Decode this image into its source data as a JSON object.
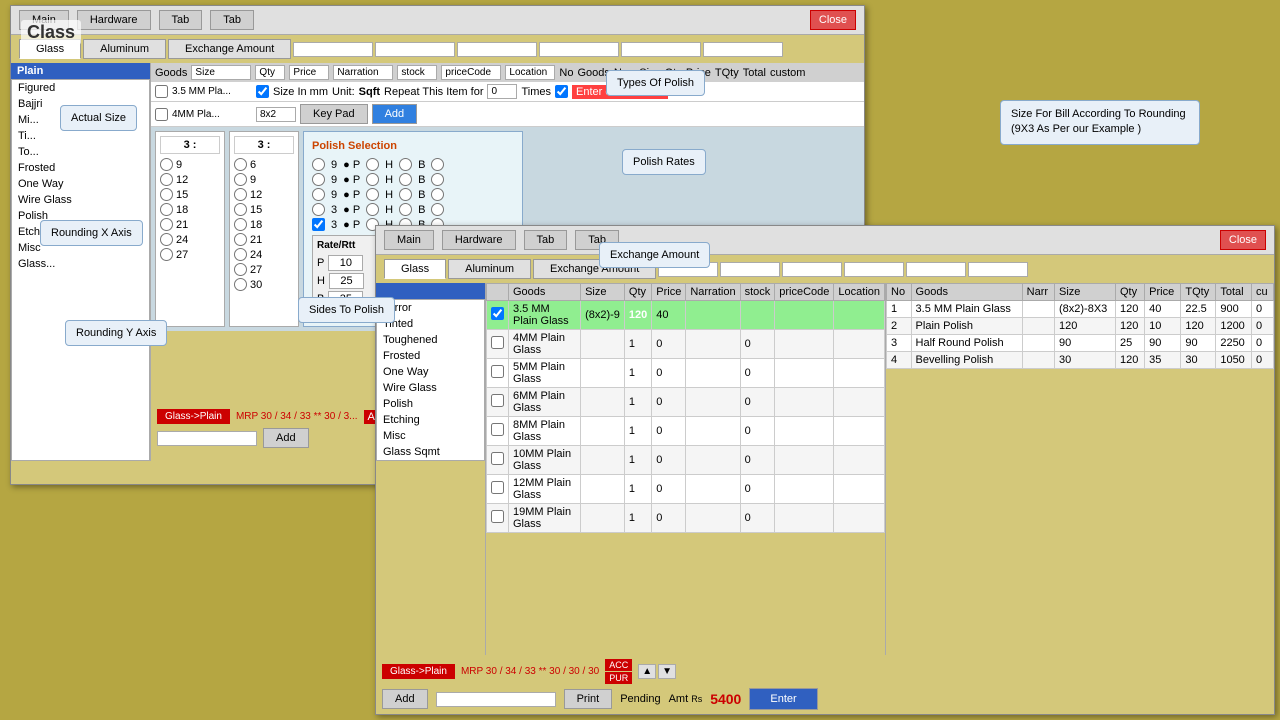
{
  "main_window": {
    "title": "Main",
    "tabs": [
      "Main",
      "Hardware",
      "Tab",
      "Tab"
    ],
    "nav_tabs": [
      "Glass",
      "Aluminum",
      "Exchange Amount"
    ],
    "close_label": "Close",
    "sidebar_items": [
      "Plain",
      "Figured",
      "Bajjri",
      "Mi...",
      "Ti...",
      "To...",
      "Frosted",
      "One Way",
      "Wire Glass",
      "Polish",
      "Etching",
      "Misc",
      "Glass..."
    ],
    "selected_sidebar": "Plain",
    "goods_columns": [
      "Goods",
      "Size",
      "Qty",
      "Price",
      "Narration",
      "stock",
      "priceCode",
      "Location",
      "No",
      "Goods",
      "Narr",
      "Size",
      "Qty",
      "Price",
      "TQty",
      "Total",
      "custom"
    ],
    "goods_rows": [
      {
        "goods": "3.5 MM Pla...",
        "size": "",
        "qty": "",
        "price": "",
        "narration": "",
        "stock": "",
        "priceCode": "",
        "location": ""
      },
      {
        "goods": "4MM Pla...",
        "size": "8x2",
        "qty": "",
        "price": "",
        "narration": "",
        "stock": "",
        "priceCode": "",
        "location": ""
      }
    ],
    "size_in_mm": true,
    "unit": "Sqft",
    "repeat_label": "Repeat This Item for",
    "repeat_value": "0",
    "times_label": "Times",
    "enter_on_selection": true,
    "keypad_label": "Key Pad",
    "add_label": "Add",
    "size_rows_left": [
      "9",
      "12",
      "15",
      "18",
      "21",
      "24",
      "27"
    ],
    "size_rows_right": [
      "6",
      "9",
      "12",
      "15",
      "18",
      "21",
      "24",
      "27",
      "30"
    ],
    "x_value": "3",
    "y_value": "3",
    "glass_plain_label": "Glass->Plain",
    "mrp_label": "MRP 30 / 34 / 33 ** 30 / 3...",
    "acc_label": "ACC",
    "pur_label": "PUR",
    "add_btn": "Add"
  },
  "polish_panel": {
    "title": "Polish Selection",
    "options": [
      {
        "val": "9",
        "p": true,
        "h": false,
        "b": false
      },
      {
        "val": "9",
        "p": true,
        "h": false,
        "b": false
      },
      {
        "val": "9",
        "p": true,
        "h": false,
        "b": false
      },
      {
        "val": "3",
        "p": true,
        "h": false,
        "b": false
      },
      {
        "val": "3",
        "p": true,
        "h": false,
        "b": false
      }
    ],
    "rate_label": "Rate/Rtt",
    "rate_p": "10",
    "rate_h": "25",
    "rate_b": "35"
  },
  "callouts": {
    "actual_size": "Actual Size",
    "rounding_x": "Rounding X Axis",
    "rounding_y": "Rounding Y Axis",
    "sides_to_polish": "Sides To Polish",
    "types_of_polish": "Types Of Polish",
    "polish_rates": "Polish Rates",
    "exchange_amount": "Exchange Amount",
    "size_for_bill": "Size For Bill According To Rounding\n(9X3 As Per our Example )"
  },
  "second_window": {
    "title": "Main",
    "tabs": [
      "Main",
      "Hardware",
      "Tab",
      "Tab"
    ],
    "nav_tabs": [
      "Glass",
      "Aluminum",
      "Exchange Amount"
    ],
    "close_label": "Close",
    "goods_columns": [
      "Goods",
      "Size",
      "Qty",
      "Price",
      "Narration",
      "stock",
      "priceCode",
      "Location"
    ],
    "goods_rows": [
      {
        "id": 1,
        "goods": "3.5 MM Plain Glass",
        "size": "(8x2)-9",
        "qty": "120",
        "price": "40",
        "narration": "",
        "stock": "",
        "priceCode": "",
        "location": "",
        "selected": true
      },
      {
        "id": 2,
        "goods": "4MM Plain Glass",
        "size": "",
        "qty": "1",
        "price": "0",
        "narration": "",
        "stock": "",
        "priceCode": "",
        "location": ""
      },
      {
        "id": 3,
        "goods": "5MM Plain Glass",
        "size": "",
        "qty": "1",
        "price": "0",
        "narration": "",
        "stock": "",
        "priceCode": "",
        "location": ""
      },
      {
        "id": 4,
        "goods": "6MM Plain Glass",
        "size": "",
        "qty": "1",
        "price": "0",
        "narration": "",
        "stock": "",
        "priceCode": "",
        "location": ""
      },
      {
        "id": 5,
        "goods": "8MM Plain Glass",
        "size": "",
        "qty": "1",
        "price": "0",
        "narration": "",
        "stock": "",
        "priceCode": "",
        "location": ""
      },
      {
        "id": 6,
        "goods": "10MM Plain Glass",
        "size": "",
        "qty": "1",
        "price": "0",
        "narration": "",
        "stock": "",
        "priceCode": "",
        "location": ""
      },
      {
        "id": 7,
        "goods": "12MM Plain Glass",
        "size": "",
        "qty": "1",
        "price": "0",
        "narration": "",
        "stock": "",
        "priceCode": "",
        "location": ""
      },
      {
        "id": 8,
        "goods": "19MM Plain Glass",
        "size": "",
        "qty": "1",
        "price": "0",
        "narration": "",
        "stock": "",
        "priceCode": "",
        "location": ""
      }
    ],
    "right_columns": [
      "No",
      "Goods",
      "Narr",
      "Size",
      "Qty",
      "Price",
      "TQty",
      "Total",
      "cu"
    ],
    "right_rows": [
      {
        "no": "1",
        "goods": "3.5 MM Plain Glass",
        "narr": "",
        "size": "(8x2)-8X3",
        "qty": "120",
        "price": "40",
        "tqty": "22.5",
        "total": "900"
      },
      {
        "no": "2",
        "goods": "Plain Polish",
        "narr": "",
        "size": "120",
        "qty": "120",
        "price": "10",
        "tqty": "120",
        "total": "1200"
      },
      {
        "no": "3",
        "goods": "Half Round Polish",
        "narr": "",
        "size": "90",
        "qty": "25",
        "price": "90",
        "tqty": "90",
        "total": "2250"
      },
      {
        "no": "4",
        "goods": "Bevelling Polish",
        "narr": "",
        "size": "30",
        "qty": "120",
        "price": "35",
        "tqty": "30",
        "total": "1050"
      }
    ],
    "sides_list": [
      "Mirror",
      "Tinted",
      "Toughened",
      "Frosted",
      "One Way",
      "Wire Glass",
      "Polish",
      "Etching",
      "Misc",
      "Glass Sqmt"
    ],
    "glass_plain_label": "Glass->Plain",
    "mrp_label": "MRP 30 / 34 / 33 ** 30 / 30 / 30",
    "acc_label": "ACC",
    "pur_label": "PUR",
    "add_btn": "Add",
    "print_btn": "Print",
    "pending_label": "Pending",
    "amt_label": "Amt",
    "rs_label": "Rs",
    "amt_value": "5400",
    "enter_btn": "Enter"
  }
}
